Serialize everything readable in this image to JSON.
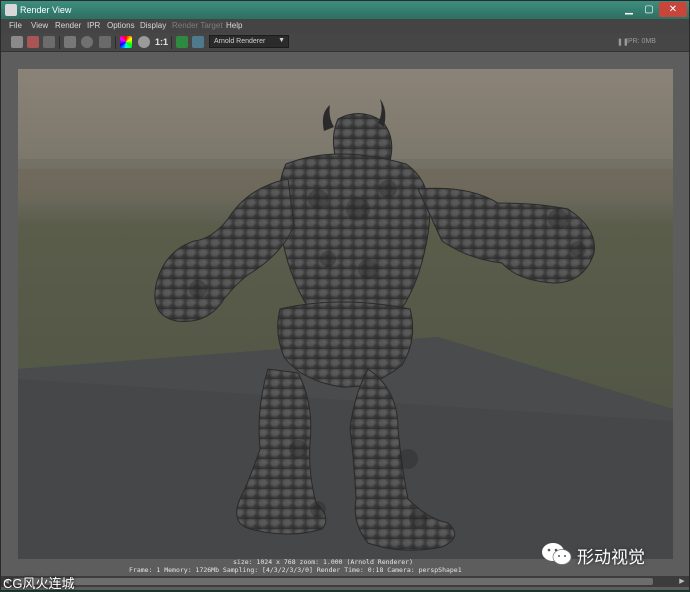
{
  "window": {
    "title": "Render View"
  },
  "menu": [
    "File",
    "View",
    "Render",
    "IPR",
    "Options",
    "Display",
    "Render Target",
    "Help"
  ],
  "toolbar": {
    "one_to_one": "1:1",
    "renderer": "Arnold Renderer",
    "ipr_readout": "IPR: 0MB"
  },
  "status": {
    "line1": "size: 1024 x 768  zoom: 1.000    (Arnold Renderer)",
    "line2": "Frame: 1    Memory: 1726Mb    Sampling: [4/3/2/3/3/0]    Render Time: 0:18    Camera: perspShape1"
  },
  "colors": {
    "accent": "#2e6f62",
    "window_bg": "#5d5d5d"
  },
  "watermarks": {
    "left": "CG风火连城",
    "right": "形动视觉"
  }
}
